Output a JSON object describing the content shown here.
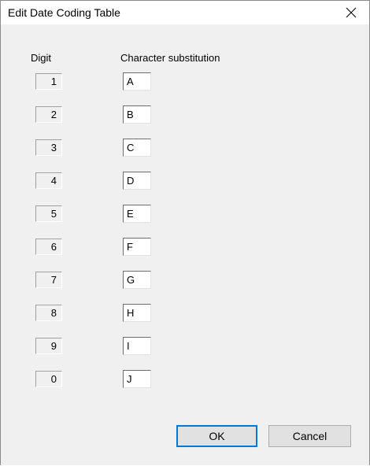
{
  "window": {
    "title": "Edit Date Coding Table"
  },
  "headers": {
    "digit": "Digit",
    "character": "Character substitution"
  },
  "rows": [
    {
      "digit": "1",
      "char": "A"
    },
    {
      "digit": "2",
      "char": "B"
    },
    {
      "digit": "3",
      "char": "C"
    },
    {
      "digit": "4",
      "char": "D"
    },
    {
      "digit": "5",
      "char": "E"
    },
    {
      "digit": "6",
      "char": "F"
    },
    {
      "digit": "7",
      "char": "G"
    },
    {
      "digit": "8",
      "char": "H"
    },
    {
      "digit": "9",
      "char": "I"
    },
    {
      "digit": "0",
      "char": "J"
    }
  ],
  "buttons": {
    "ok": "OK",
    "cancel": "Cancel"
  },
  "icons": {
    "close": "close-icon"
  }
}
